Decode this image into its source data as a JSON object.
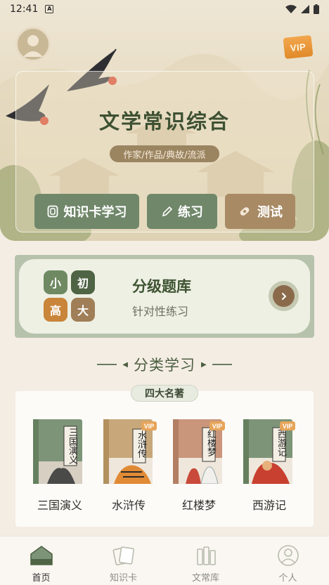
{
  "status_bar": {
    "time": "12:41",
    "notification_letter": "A"
  },
  "hero": {
    "title": "文学常识综合",
    "tag": "作家/作品/典故/流派",
    "vip_label": "VIP",
    "buttons": {
      "knowledge": "知识卡学习",
      "practice": "练习",
      "test": "测试"
    }
  },
  "level_bank": {
    "tiles": [
      "小",
      "初",
      "高",
      "大"
    ],
    "tile_colors": [
      "#6f8a63",
      "#4e6444",
      "#c9853a",
      "#a07e57"
    ],
    "title": "分级题库",
    "subtitle": "针对性练习"
  },
  "category": {
    "heading": "分类学习",
    "group_tag": "四大名著",
    "books": [
      {
        "title": "三国演义",
        "cover_text": "三国演义",
        "vip": false,
        "color": "#7d9478"
      },
      {
        "title": "水浒传",
        "cover_text": "水浒传",
        "vip": true,
        "vip_label": "VIP",
        "color": "#c8a87a"
      },
      {
        "title": "红楼梦",
        "cover_text": "红楼梦",
        "vip": true,
        "vip_label": "VIP",
        "color": "#c9967b"
      },
      {
        "title": "西游记",
        "cover_text": "西游记",
        "vip": true,
        "vip_label": "VIP",
        "color": "#7d9478"
      }
    ]
  },
  "nav": {
    "items": [
      {
        "label": "首页",
        "active": true
      },
      {
        "label": "知识卡",
        "active": false
      },
      {
        "label": "文常库",
        "active": false
      },
      {
        "label": "个人",
        "active": false
      }
    ]
  }
}
